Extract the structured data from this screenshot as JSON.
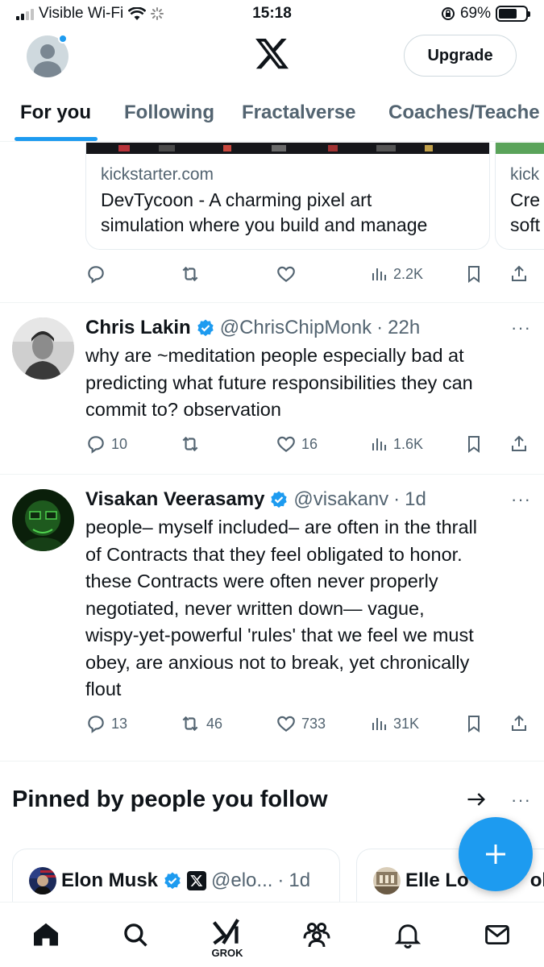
{
  "status_bar": {
    "carrier": "Visible Wi-Fi",
    "time": "15:18",
    "battery": "69%",
    "battery_level": 0.69
  },
  "header": {
    "upgrade_label": "Upgrade"
  },
  "tabs": [
    {
      "label": "For you",
      "active": true
    },
    {
      "label": "Following",
      "active": false
    },
    {
      "label": "Fractalverse",
      "active": false
    },
    {
      "label": "Coaches/Teache",
      "active": false
    }
  ],
  "cards": [
    {
      "domain": "kickstarter.com",
      "title_line1": "DevTycoon - A charming pixel art",
      "title_line2": "simulation where you build and manage"
    },
    {
      "domain": "kick",
      "title_line1": "Cre",
      "title_line2": "soft"
    }
  ],
  "card_actions": {
    "views": "2.2K"
  },
  "tweets": [
    {
      "name": "Chris Lakin",
      "handle": "@ChrisChipMonk",
      "time": "22h",
      "lines": [
        "why are ~meditation people especially bad at",
        "predicting what future responsibilities they can",
        "commit to? observation"
      ],
      "replies": "10",
      "reposts": "",
      "likes": "16",
      "views": "1.6K"
    },
    {
      "name": "Visakan Veerasamy",
      "handle": "@visakanv",
      "time": "1d",
      "lines": [
        "people– myself included– are often in the thrall",
        "of Contracts that they feel obligated to honor.",
        "these Contracts were often never properly",
        "negotiated, never written down— vague,",
        "wispy-yet-powerful 'rules' that we feel we must",
        "obey, are anxious not to break, yet chronically",
        "flout"
      ],
      "replies": "13",
      "reposts": "46",
      "likes": "733",
      "views": "31K"
    }
  ],
  "pinned": {
    "title": "Pinned by people you follow",
    "cards": [
      {
        "name": "Elon Musk",
        "handle": "@elo...",
        "time": "1d"
      },
      {
        "name": "Elle Lo",
        "handle_tail": "ok"
      }
    ]
  },
  "bottom_nav": {
    "grok_label": "GROK"
  },
  "colors": {
    "accent": "#1d9bf0",
    "text": "#0f1419",
    "secondary": "#536471"
  }
}
